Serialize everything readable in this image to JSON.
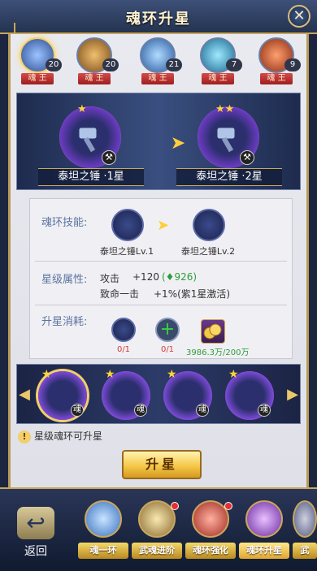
{
  "window": {
    "title": "魂环升星"
  },
  "heads": [
    {
      "count": "20",
      "tag": "魂 王",
      "color": "#4a7fd8",
      "selected": true
    },
    {
      "count": "20",
      "tag": "魂 王",
      "color": "#b87830"
    },
    {
      "count": "21",
      "tag": "魂 王",
      "color": "#4a8ae0"
    },
    {
      "count": "7",
      "tag": "魂 王",
      "color": "#3aa0d0"
    },
    {
      "count": "9",
      "tag": "魂 王",
      "color": "#d8502a"
    }
  ],
  "preview": {
    "left": {
      "name": "泰坦之锤 ·1星",
      "stars": "★"
    },
    "right": {
      "name": "泰坦之锤 ·2星",
      "stars": "★★"
    },
    "arrow": "➤"
  },
  "info": {
    "skill_label": "魂环技能:",
    "skill_from": "泰坦之锤Lv.1",
    "skill_to": "泰坦之锤Lv.2",
    "skill_arrow": "➤",
    "attr_label": "星级属性:",
    "attr1_name": "攻击",
    "attr1_value": "+120",
    "attr1_bonus": "(♦926)",
    "attr2_name": "致命一击",
    "attr2_value": "+1%(紫1星激活)",
    "cost_label": "升星消耗:",
    "cost1": "0/1",
    "cost2": "0/1",
    "cost2_icon": "+",
    "cost3": "3986.3万/200万"
  },
  "strip": {
    "left_arrow": "◀",
    "right_arrow": "▶",
    "star": "★",
    "badge": "魂"
  },
  "hint": {
    "icon": "!",
    "text": "星级魂环可升星"
  },
  "upgrade_button": "升星",
  "close_icon": "✕",
  "nav": {
    "back": "返回",
    "back_arrow": "↩",
    "tabs": [
      {
        "label": "魂一环",
        "gem": "#6ab0f0"
      },
      {
        "label": "武魂进阶",
        "gem": "#d8c080"
      },
      {
        "label": "魂环强化",
        "gem": "#e86a5a"
      },
      {
        "label": "魂环升星",
        "gem": "#b070e0",
        "active": true
      },
      {
        "label": "武"
      }
    ]
  }
}
